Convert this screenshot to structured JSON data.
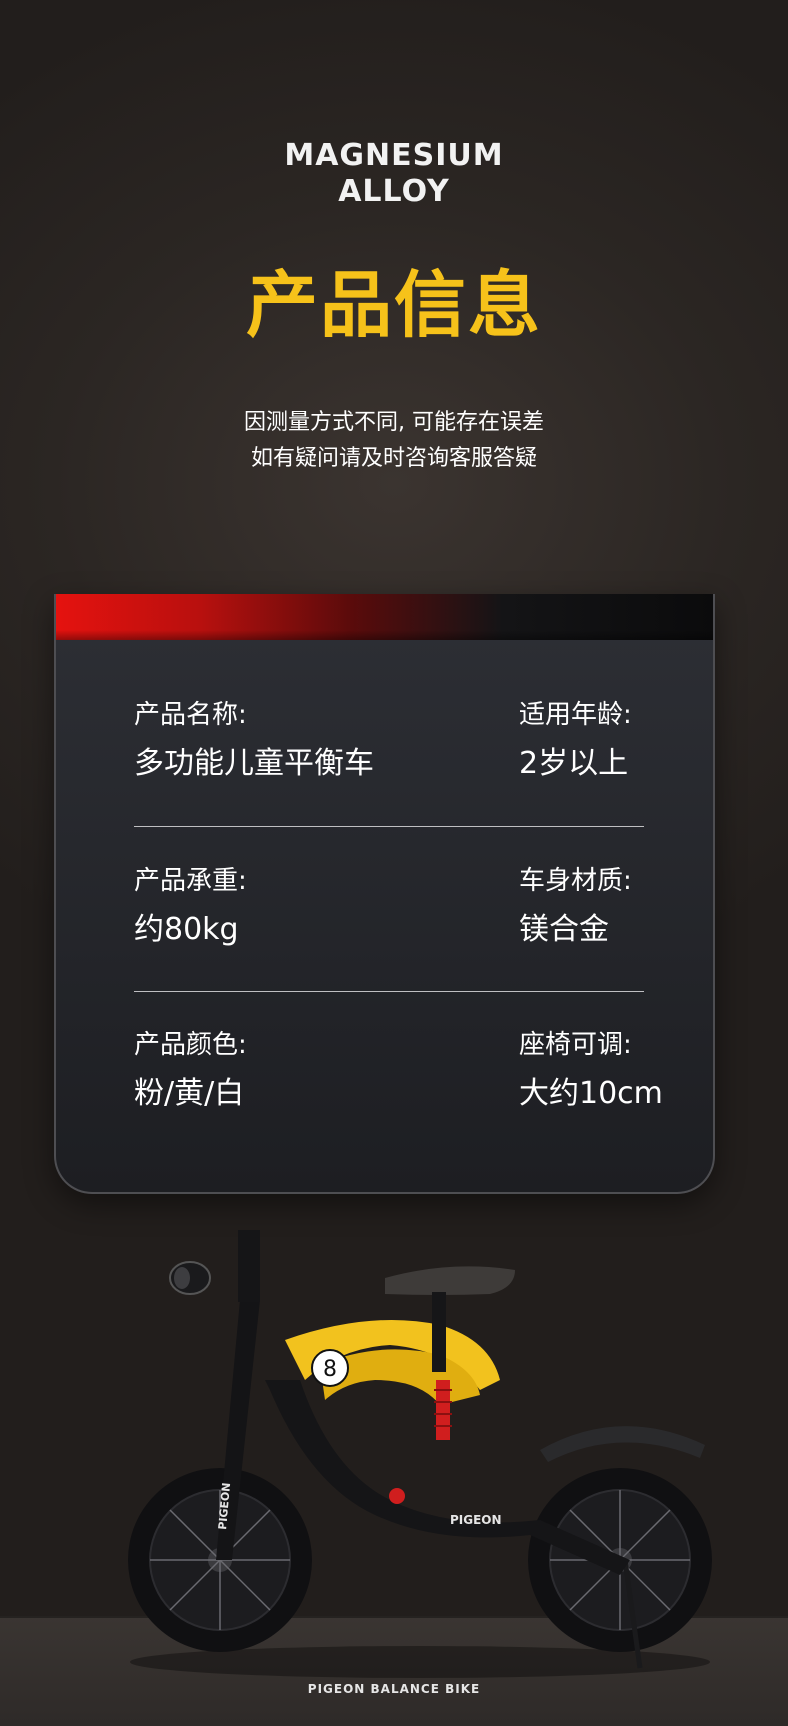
{
  "header": {
    "brand_line1": "MAGNESIUM",
    "brand_line2": "ALLOY",
    "title": "产品信息",
    "notice_line1": "因测量方式不同, 可能存在误差",
    "notice_line2": "如有疑问请及时咨询客服答疑"
  },
  "specs": [
    {
      "label": "产品名称:",
      "value": "多功能儿童平衡车"
    },
    {
      "label": "适用年龄:",
      "value": "2岁以上"
    },
    {
      "label": "产品承重:",
      "value": "约80kg"
    },
    {
      "label": "车身材质:",
      "value": "镁合金"
    },
    {
      "label": "产品颜色:",
      "value": "粉/黄/白"
    },
    {
      "label": "座椅可调:",
      "value": "大约10cm"
    }
  ],
  "bike": {
    "frame_text": "PIGEON",
    "fork_text": "PIGEON",
    "number": "8"
  },
  "footer": {
    "caption": "PIGEON BALANCE BIKE"
  },
  "colors": {
    "accent": "#f6c21a",
    "red": "#e5120f",
    "background": "#2b2623"
  }
}
